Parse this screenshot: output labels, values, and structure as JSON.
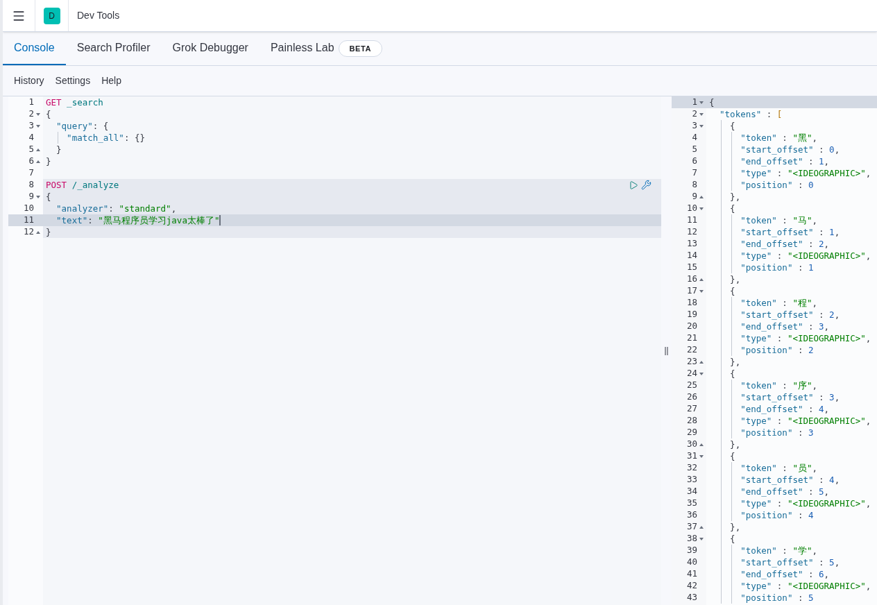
{
  "header": {
    "avatar": "D",
    "title": "Dev Tools"
  },
  "tabs": [
    {
      "label": "Console",
      "selected": true
    },
    {
      "label": "Search Profiler",
      "selected": false
    },
    {
      "label": "Grok Debugger",
      "selected": false
    },
    {
      "label": "Painless Lab",
      "selected": false,
      "badge": "BETA"
    }
  ],
  "menu": [
    "History",
    "Settings",
    "Help"
  ],
  "request_editor": {
    "requests": [
      {
        "selected": false,
        "lines": [
          {
            "number": "1",
            "kind": "plain",
            "active": false,
            "tokens": [
              {
                "kind": "keyword",
                "text": "GET"
              },
              {
                "kind": "path",
                "text": " _search"
              }
            ]
          },
          {
            "number": "2",
            "kind": "open",
            "active": false,
            "tokens": [
              {
                "kind": "punct",
                "text": "{"
              }
            ]
          },
          {
            "number": "3",
            "kind": "open",
            "active": false,
            "tokens": [
              {
                "kind": "key",
                "text": "  \"query\""
              },
              {
                "kind": "punct",
                "text": ": {"
              }
            ]
          },
          {
            "number": "4",
            "kind": "plain",
            "active": false,
            "tokens": [
              {
                "kind": "key",
                "text": "    \"match_all\""
              },
              {
                "kind": "punct",
                "text": ": {}"
              }
            ]
          },
          {
            "number": "5",
            "kind": "close",
            "active": false,
            "tokens": [
              {
                "kind": "punct",
                "text": "  }"
              }
            ]
          },
          {
            "number": "6",
            "kind": "close",
            "active": false,
            "tokens": [
              {
                "kind": "punct",
                "text": "}"
              }
            ]
          },
          {
            "number": "7",
            "kind": "plain",
            "active": false
          }
        ]
      },
      {
        "selected": true,
        "lines": [
          {
            "number": "8",
            "kind": "plain",
            "active": false,
            "actions": true,
            "tokens": [
              {
                "kind": "keyword",
                "text": "POST"
              },
              {
                "kind": "path",
                "text": " /_analyze"
              }
            ]
          },
          {
            "number": "9",
            "kind": "open",
            "active": false,
            "tokens": [
              {
                "kind": "punct",
                "text": "{"
              }
            ]
          },
          {
            "number": "10",
            "kind": "plain",
            "active": false,
            "tokens": [
              {
                "kind": "key",
                "text": "  \"analyzer\""
              },
              {
                "kind": "punct",
                "text": ": "
              },
              {
                "kind": "string",
                "text": "\"standard\""
              },
              {
                "kind": "punct",
                "text": ","
              }
            ]
          },
          {
            "number": "11",
            "kind": "plain",
            "active": true,
            "cursor": true,
            "tokens": [
              {
                "kind": "key",
                "text": "  \"text\""
              },
              {
                "kind": "punct",
                "text": ": "
              },
              {
                "kind": "string",
                "text": "\"黑马程序员学习java太棒了\""
              }
            ]
          },
          {
            "number": "12",
            "kind": "close",
            "active": false,
            "tokens": [
              {
                "kind": "punct",
                "text": "}"
              }
            ]
          }
        ]
      }
    ]
  },
  "response_editor": {
    "lines": [
      {
        "number": "1",
        "kind": "open",
        "active": true,
        "tokens": [
          {
            "kind": "punct",
            "text": "{"
          }
        ]
      },
      {
        "number": "2",
        "kind": "open",
        "active": false,
        "tokens": [
          {
            "kind": "key",
            "text": "  \"tokens\""
          },
          {
            "kind": "punct",
            "text": " : "
          },
          {
            "kind": "bracket",
            "text": "["
          }
        ]
      },
      {
        "number": "3",
        "kind": "open",
        "active": false,
        "tokens": [
          {
            "kind": "punct",
            "text": "    {"
          }
        ]
      },
      {
        "number": "4",
        "kind": "plain",
        "active": false,
        "tokens": [
          {
            "kind": "key",
            "text": "      \"token\""
          },
          {
            "kind": "punct",
            "text": " : "
          },
          {
            "kind": "string",
            "text": "\"黑\""
          },
          {
            "kind": "punct",
            "text": ","
          }
        ]
      },
      {
        "number": "5",
        "kind": "plain",
        "active": false,
        "tokens": [
          {
            "kind": "key",
            "text": "      \"start_offset\""
          },
          {
            "kind": "punct",
            "text": " : "
          },
          {
            "kind": "number",
            "text": "0"
          },
          {
            "kind": "punct",
            "text": ","
          }
        ]
      },
      {
        "number": "6",
        "kind": "plain",
        "active": false,
        "tokens": [
          {
            "kind": "key",
            "text": "      \"end_offset\""
          },
          {
            "kind": "punct",
            "text": " : "
          },
          {
            "kind": "number",
            "text": "1"
          },
          {
            "kind": "punct",
            "text": ","
          }
        ]
      },
      {
        "number": "7",
        "kind": "plain",
        "active": false,
        "tokens": [
          {
            "kind": "key",
            "text": "      \"type\""
          },
          {
            "kind": "punct",
            "text": " : "
          },
          {
            "kind": "string",
            "text": "\"<IDEOGRAPHIC>\""
          },
          {
            "kind": "punct",
            "text": ","
          }
        ]
      },
      {
        "number": "8",
        "kind": "plain",
        "active": false,
        "tokens": [
          {
            "kind": "key",
            "text": "      \"position\""
          },
          {
            "kind": "punct",
            "text": " : "
          },
          {
            "kind": "number",
            "text": "0"
          }
        ]
      },
      {
        "number": "9",
        "kind": "close",
        "active": false,
        "tokens": [
          {
            "kind": "punct",
            "text": "    },"
          }
        ]
      },
      {
        "number": "10",
        "kind": "open",
        "active": false,
        "tokens": [
          {
            "kind": "punct",
            "text": "    {"
          }
        ]
      },
      {
        "number": "11",
        "kind": "plain",
        "active": false,
        "tokens": [
          {
            "kind": "key",
            "text": "      \"token\""
          },
          {
            "kind": "punct",
            "text": " : "
          },
          {
            "kind": "string",
            "text": "\"马\""
          },
          {
            "kind": "punct",
            "text": ","
          }
        ]
      },
      {
        "number": "12",
        "kind": "plain",
        "active": false,
        "tokens": [
          {
            "kind": "key",
            "text": "      \"start_offset\""
          },
          {
            "kind": "punct",
            "text": " : "
          },
          {
            "kind": "number",
            "text": "1"
          },
          {
            "kind": "punct",
            "text": ","
          }
        ]
      },
      {
        "number": "13",
        "kind": "plain",
        "active": false,
        "tokens": [
          {
            "kind": "key",
            "text": "      \"end_offset\""
          },
          {
            "kind": "punct",
            "text": " : "
          },
          {
            "kind": "number",
            "text": "2"
          },
          {
            "kind": "punct",
            "text": ","
          }
        ]
      },
      {
        "number": "14",
        "kind": "plain",
        "active": false,
        "tokens": [
          {
            "kind": "key",
            "text": "      \"type\""
          },
          {
            "kind": "punct",
            "text": " : "
          },
          {
            "kind": "string",
            "text": "\"<IDEOGRAPHIC>\""
          },
          {
            "kind": "punct",
            "text": ","
          }
        ]
      },
      {
        "number": "15",
        "kind": "plain",
        "active": false,
        "tokens": [
          {
            "kind": "key",
            "text": "      \"position\""
          },
          {
            "kind": "punct",
            "text": " : "
          },
          {
            "kind": "number",
            "text": "1"
          }
        ]
      },
      {
        "number": "16",
        "kind": "close",
        "active": false,
        "tokens": [
          {
            "kind": "punct",
            "text": "    },"
          }
        ]
      },
      {
        "number": "17",
        "kind": "open",
        "active": false,
        "tokens": [
          {
            "kind": "punct",
            "text": "    {"
          }
        ]
      },
      {
        "number": "18",
        "kind": "plain",
        "active": false,
        "tokens": [
          {
            "kind": "key",
            "text": "      \"token\""
          },
          {
            "kind": "punct",
            "text": " : "
          },
          {
            "kind": "string",
            "text": "\"程\""
          },
          {
            "kind": "punct",
            "text": ","
          }
        ]
      },
      {
        "number": "19",
        "kind": "plain",
        "active": false,
        "tokens": [
          {
            "kind": "key",
            "text": "      \"start_offset\""
          },
          {
            "kind": "punct",
            "text": " : "
          },
          {
            "kind": "number",
            "text": "2"
          },
          {
            "kind": "punct",
            "text": ","
          }
        ]
      },
      {
        "number": "20",
        "kind": "plain",
        "active": false,
        "tokens": [
          {
            "kind": "key",
            "text": "      \"end_offset\""
          },
          {
            "kind": "punct",
            "text": " : "
          },
          {
            "kind": "number",
            "text": "3"
          },
          {
            "kind": "punct",
            "text": ","
          }
        ]
      },
      {
        "number": "21",
        "kind": "plain",
        "active": false,
        "tokens": [
          {
            "kind": "key",
            "text": "      \"type\""
          },
          {
            "kind": "punct",
            "text": " : "
          },
          {
            "kind": "string",
            "text": "\"<IDEOGRAPHIC>\""
          },
          {
            "kind": "punct",
            "text": ","
          }
        ]
      },
      {
        "number": "22",
        "kind": "plain",
        "active": false,
        "tokens": [
          {
            "kind": "key",
            "text": "      \"position\""
          },
          {
            "kind": "punct",
            "text": " : "
          },
          {
            "kind": "number",
            "text": "2"
          }
        ]
      },
      {
        "number": "23",
        "kind": "close",
        "active": false,
        "tokens": [
          {
            "kind": "punct",
            "text": "    },"
          }
        ]
      },
      {
        "number": "24",
        "kind": "open",
        "active": false,
        "tokens": [
          {
            "kind": "punct",
            "text": "    {"
          }
        ]
      },
      {
        "number": "25",
        "kind": "plain",
        "active": false,
        "tokens": [
          {
            "kind": "key",
            "text": "      \"token\""
          },
          {
            "kind": "punct",
            "text": " : "
          },
          {
            "kind": "string",
            "text": "\"序\""
          },
          {
            "kind": "punct",
            "text": ","
          }
        ]
      },
      {
        "number": "26",
        "kind": "plain",
        "active": false,
        "tokens": [
          {
            "kind": "key",
            "text": "      \"start_offset\""
          },
          {
            "kind": "punct",
            "text": " : "
          },
          {
            "kind": "number",
            "text": "3"
          },
          {
            "kind": "punct",
            "text": ","
          }
        ]
      },
      {
        "number": "27",
        "kind": "plain",
        "active": false,
        "tokens": [
          {
            "kind": "key",
            "text": "      \"end_offset\""
          },
          {
            "kind": "punct",
            "text": " : "
          },
          {
            "kind": "number",
            "text": "4"
          },
          {
            "kind": "punct",
            "text": ","
          }
        ]
      },
      {
        "number": "28",
        "kind": "plain",
        "active": false,
        "tokens": [
          {
            "kind": "key",
            "text": "      \"type\""
          },
          {
            "kind": "punct",
            "text": " : "
          },
          {
            "kind": "string",
            "text": "\"<IDEOGRAPHIC>\""
          },
          {
            "kind": "punct",
            "text": ","
          }
        ]
      },
      {
        "number": "29",
        "kind": "plain",
        "active": false,
        "tokens": [
          {
            "kind": "key",
            "text": "      \"position\""
          },
          {
            "kind": "punct",
            "text": " : "
          },
          {
            "kind": "number",
            "text": "3"
          }
        ]
      },
      {
        "number": "30",
        "kind": "close",
        "active": false,
        "tokens": [
          {
            "kind": "punct",
            "text": "    },"
          }
        ]
      },
      {
        "number": "31",
        "kind": "open",
        "active": false,
        "tokens": [
          {
            "kind": "punct",
            "text": "    {"
          }
        ]
      },
      {
        "number": "32",
        "kind": "plain",
        "active": false,
        "tokens": [
          {
            "kind": "key",
            "text": "      \"token\""
          },
          {
            "kind": "punct",
            "text": " : "
          },
          {
            "kind": "string",
            "text": "\"员\""
          },
          {
            "kind": "punct",
            "text": ","
          }
        ]
      },
      {
        "number": "33",
        "kind": "plain",
        "active": false,
        "tokens": [
          {
            "kind": "key",
            "text": "      \"start_offset\""
          },
          {
            "kind": "punct",
            "text": " : "
          },
          {
            "kind": "number",
            "text": "4"
          },
          {
            "kind": "punct",
            "text": ","
          }
        ]
      },
      {
        "number": "34",
        "kind": "plain",
        "active": false,
        "tokens": [
          {
            "kind": "key",
            "text": "      \"end_offset\""
          },
          {
            "kind": "punct",
            "text": " : "
          },
          {
            "kind": "number",
            "text": "5"
          },
          {
            "kind": "punct",
            "text": ","
          }
        ]
      },
      {
        "number": "35",
        "kind": "plain",
        "active": false,
        "tokens": [
          {
            "kind": "key",
            "text": "      \"type\""
          },
          {
            "kind": "punct",
            "text": " : "
          },
          {
            "kind": "string",
            "text": "\"<IDEOGRAPHIC>\""
          },
          {
            "kind": "punct",
            "text": ","
          }
        ]
      },
      {
        "number": "36",
        "kind": "plain",
        "active": false,
        "tokens": [
          {
            "kind": "key",
            "text": "      \"position\""
          },
          {
            "kind": "punct",
            "text": " : "
          },
          {
            "kind": "number",
            "text": "4"
          }
        ]
      },
      {
        "number": "37",
        "kind": "close",
        "active": false,
        "tokens": [
          {
            "kind": "punct",
            "text": "    },"
          }
        ]
      },
      {
        "number": "38",
        "kind": "open",
        "active": false,
        "tokens": [
          {
            "kind": "punct",
            "text": "    {"
          }
        ]
      },
      {
        "number": "39",
        "kind": "plain",
        "active": false,
        "tokens": [
          {
            "kind": "key",
            "text": "      \"token\""
          },
          {
            "kind": "punct",
            "text": " : "
          },
          {
            "kind": "string",
            "text": "\"学\""
          },
          {
            "kind": "punct",
            "text": ","
          }
        ]
      },
      {
        "number": "40",
        "kind": "plain",
        "active": false,
        "tokens": [
          {
            "kind": "key",
            "text": "      \"start_offset\""
          },
          {
            "kind": "punct",
            "text": " : "
          },
          {
            "kind": "number",
            "text": "5"
          },
          {
            "kind": "punct",
            "text": ","
          }
        ]
      },
      {
        "number": "41",
        "kind": "plain",
        "active": false,
        "tokens": [
          {
            "kind": "key",
            "text": "      \"end_offset\""
          },
          {
            "kind": "punct",
            "text": " : "
          },
          {
            "kind": "number",
            "text": "6"
          },
          {
            "kind": "punct",
            "text": ","
          }
        ]
      },
      {
        "number": "42",
        "kind": "plain",
        "active": false,
        "tokens": [
          {
            "kind": "key",
            "text": "      \"type\""
          },
          {
            "kind": "punct",
            "text": " : "
          },
          {
            "kind": "string",
            "text": "\"<IDEOGRAPHIC>\""
          },
          {
            "kind": "punct",
            "text": ","
          }
        ]
      },
      {
        "number": "43",
        "kind": "plain",
        "active": false,
        "tokens": [
          {
            "kind": "key",
            "text": "      \"position\""
          },
          {
            "kind": "punct",
            "text": " : "
          },
          {
            "kind": "number",
            "text": "5"
          }
        ]
      }
    ]
  }
}
